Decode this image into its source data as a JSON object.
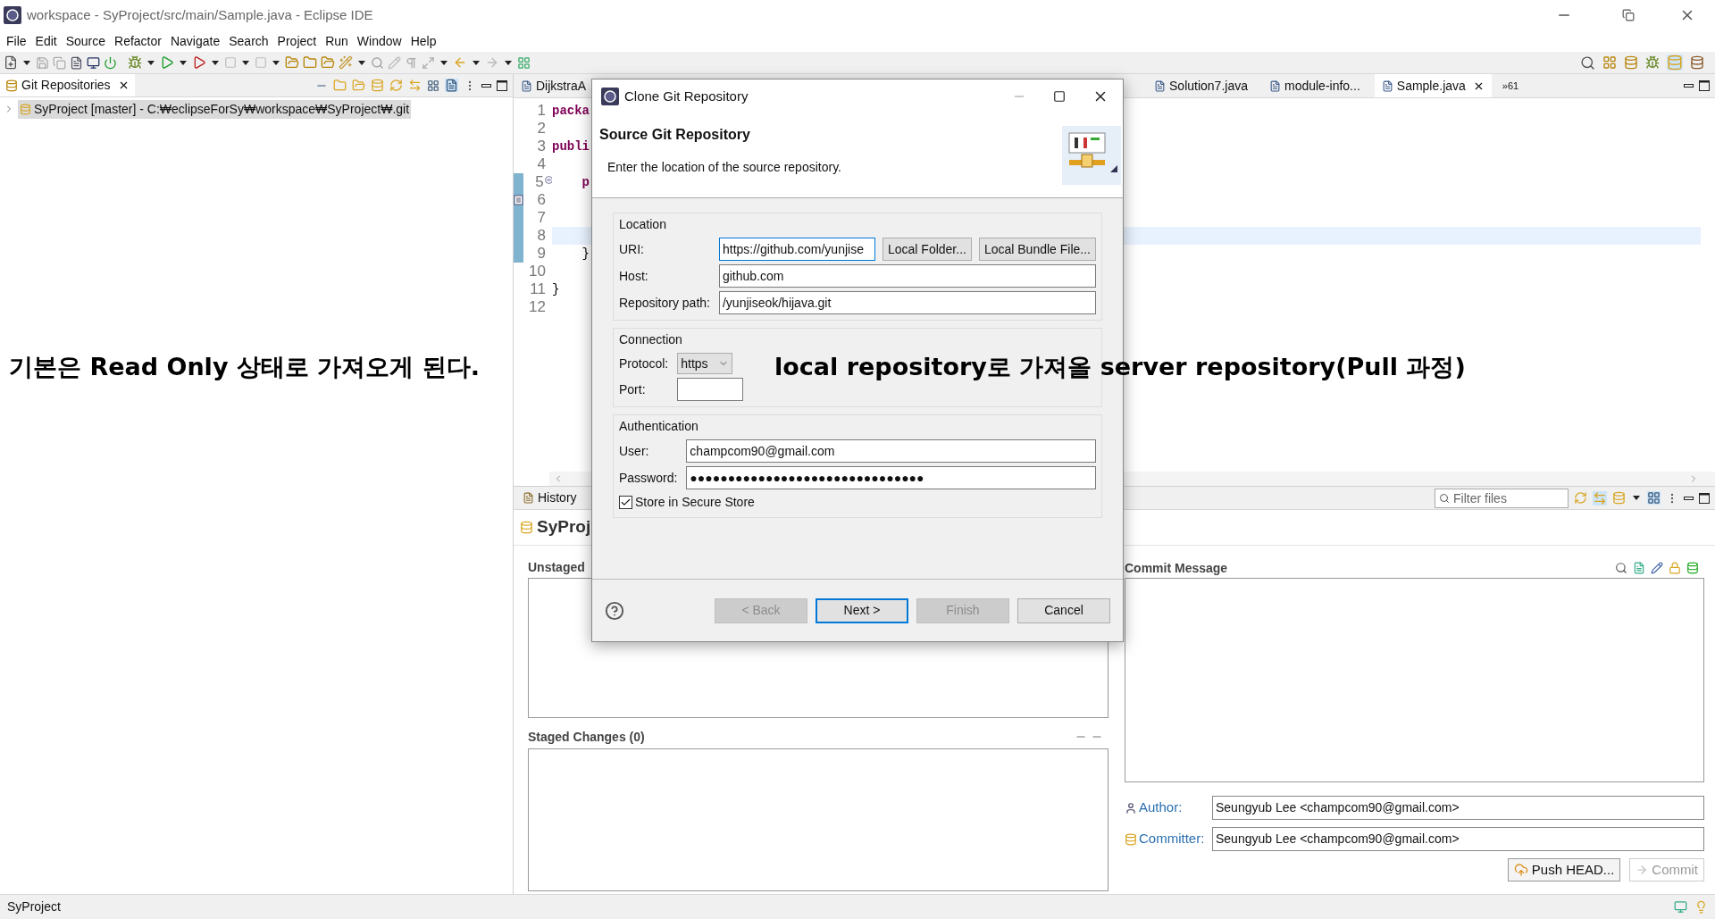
{
  "window": {
    "title": "workspace - SyProject/src/main/Sample.java - Eclipse IDE"
  },
  "menu": [
    "File",
    "Edit",
    "Source",
    "Refactor",
    "Navigate",
    "Search",
    "Project",
    "Run",
    "Window",
    "Help"
  ],
  "repositories_view": {
    "title": "Git Repositories",
    "items": [
      {
        "label": "SyProject [master] - C:₩eclipseForSy₩workspace₩SyProject₩.git",
        "selected": true,
        "expanded": false
      }
    ]
  },
  "editor": {
    "tabs": [
      {
        "label": "DijkstraA",
        "selected": false
      },
      {
        "label": "Solution7.java",
        "selected": false
      },
      {
        "label": "module-info...",
        "selected": false
      },
      {
        "label": "Sample.java",
        "selected": true
      }
    ],
    "overflow": "»61",
    "lines": [
      {
        "number": "1",
        "tokens": [
          {
            "kind": "keyword",
            "text": "packa"
          }
        ],
        "current": false,
        "foldable": false,
        "changed": false,
        "task_marker": false
      },
      {
        "number": "2",
        "current": false,
        "foldable": false,
        "changed": false,
        "task_marker": false
      },
      {
        "number": "3",
        "tokens": [
          {
            "kind": "keyword",
            "text": "publi"
          }
        ],
        "current": false,
        "foldable": false,
        "changed": false,
        "task_marker": false
      },
      {
        "number": "4",
        "current": false,
        "foldable": false,
        "changed": false,
        "task_marker": false
      },
      {
        "number": "5",
        "tokens": [
          {
            "kind": "keyword",
            "text": "    p"
          }
        ],
        "current": false,
        "foldable": true,
        "changed": true,
        "task_marker": false
      },
      {
        "number": "6",
        "current": false,
        "foldable": false,
        "changed": true,
        "task_marker": true
      },
      {
        "number": "7",
        "current": false,
        "foldable": false,
        "changed": true,
        "task_marker": false
      },
      {
        "number": "8",
        "current": true,
        "foldable": false,
        "changed": true,
        "task_marker": false
      },
      {
        "number": "9",
        "tokens": [
          {
            "kind": "plain",
            "text": "    }"
          }
        ],
        "current": false,
        "foldable": false,
        "changed": true,
        "task_marker": false
      },
      {
        "number": "10",
        "current": false,
        "foldable": false,
        "changed": false,
        "task_marker": false
      },
      {
        "number": "11",
        "tokens": [
          {
            "kind": "plain",
            "text": "}"
          }
        ],
        "current": false,
        "foldable": false,
        "changed": false,
        "task_marker": false
      },
      {
        "number": "12",
        "current": false,
        "foldable": false,
        "changed": false,
        "task_marker": false
      }
    ]
  },
  "annotations": [
    "기본은 Read Only 상태로 가져오게 된다.",
    "local repository로 가져올 server repository(Pull 과정)"
  ],
  "staging_view": {
    "tab": "History",
    "filter_placeholder": "Filter files",
    "repository": "SyProj",
    "unstaged_title": "Unstaged",
    "staged_title": "Staged Changes (0)",
    "commit_message_title": "Commit Message",
    "author_label": "Author:",
    "author": "Seungyub Lee <champcom90@gmail.com>",
    "committer_label": "Committer:",
    "committer": "Seungyub Lee <champcom90@gmail.com>",
    "buttons": [
      {
        "label": "Push HEAD...",
        "disabled": false
      },
      {
        "label": "Commit",
        "disabled": true
      }
    ]
  },
  "dialog": {
    "title": "Clone Git Repository",
    "heading": "Source Git Repository",
    "description": "Enter the location of the source repository.",
    "groups": [
      {
        "title": "Location",
        "fields": [
          {
            "kind": "text",
            "label": "URI:",
            "value": "https://github.com/yunjise",
            "focused": true,
            "buttons": [
              "Local Folder...",
              "Local Bundle File..."
            ]
          },
          {
            "kind": "text",
            "label": "Host:",
            "value": "github.com",
            "focused": false
          },
          {
            "kind": "text",
            "label": "Repository path:",
            "value": "/yunjiseok/hijava.git",
            "focused": false
          }
        ]
      },
      {
        "title": "Connection",
        "fields": [
          {
            "kind": "select",
            "label": "Protocol:",
            "value": "https"
          },
          {
            "kind": "number",
            "label": "Port:"
          }
        ]
      },
      {
        "title": "Authentication",
        "fields": [
          {
            "kind": "text",
            "label": "User:",
            "value": "champcom90@gmail.com",
            "focused": false
          },
          {
            "kind": "text",
            "label": "Password:",
            "value": "●●●●●●●●●●●●●●●●●●●●●●●●●●●●●●●",
            "focused": false
          },
          {
            "kind": "checkbox",
            "label": "Store in Secure Store",
            "checked": true
          }
        ]
      }
    ],
    "buttons": [
      {
        "label": "< Back",
        "disabled": true,
        "default": false
      },
      {
        "label": "Next >",
        "disabled": false,
        "default": true
      },
      {
        "label": "Finish",
        "disabled": true,
        "default": false
      },
      {
        "label": "Cancel",
        "disabled": false,
        "default": false
      }
    ]
  },
  "status_bar": {
    "text": "SyProject"
  }
}
